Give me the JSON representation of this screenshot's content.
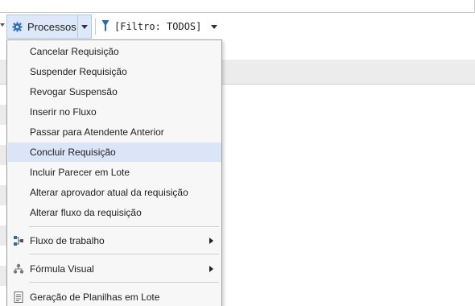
{
  "toolbar": {
    "processes_label": "Processos",
    "filter_label": "[Filtro: TODOS]"
  },
  "menu": {
    "items": [
      {
        "label": "Cancelar Requisição"
      },
      {
        "label": "Suspender Requisição"
      },
      {
        "label": "Revogar Suspensão"
      },
      {
        "label": "Inserir no Fluxo"
      },
      {
        "label": "Passar para Atendente Anterior"
      },
      {
        "label": "Concluir Requisição",
        "highlighted": true
      },
      {
        "label": "Incluir Parecer em Lote"
      },
      {
        "label": "Alterar aprovador atual da requisição"
      },
      {
        "label": "Alterar fluxo da requisição"
      }
    ],
    "workflow": {
      "label": "Fluxo de trabalho",
      "icon": "workflow-icon"
    },
    "visual_formula": {
      "label": "Fórmula Visual",
      "icon": "formula-icon"
    },
    "spreadsheets": {
      "label": "Geração de Planilhas em Lote",
      "icon": "spreadsheet-icon"
    }
  },
  "colors": {
    "highlight": "#dae6f7",
    "button_bg": "#dde8f8",
    "menu_bg": "#f7f7f7",
    "icon_blue": "#2a6bb8"
  }
}
